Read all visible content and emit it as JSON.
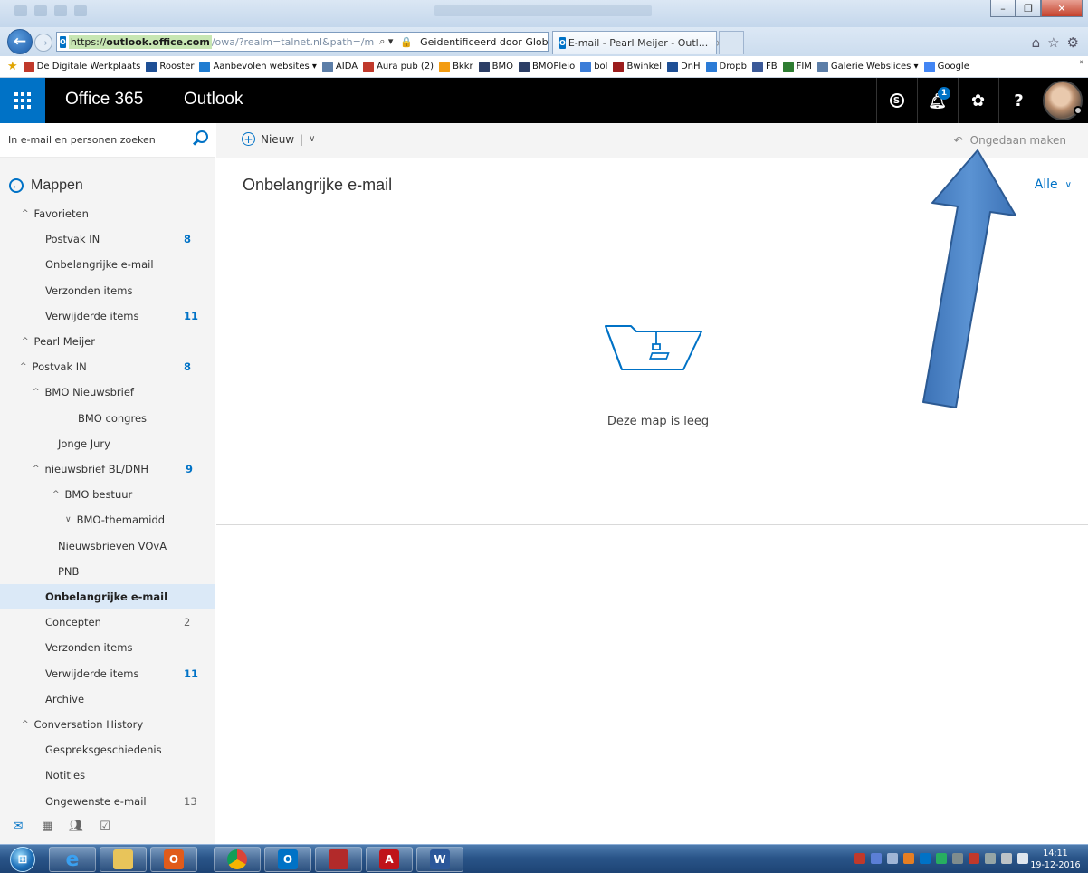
{
  "browser": {
    "address": {
      "url_prefix": "https://",
      "url_host": "outlook.office.com",
      "url_path": "/owa/?realm=talnet.nl&path=/m",
      "search_icon": "search-icon",
      "security_text": "Geidentificeerd door Glob..."
    },
    "tab": {
      "title": "E-mail - Pearl Meijer - Outl...",
      "close": "×"
    },
    "favorites": [
      {
        "label": "De Digitale Werkplaats",
        "color": "#c0392b"
      },
      {
        "label": "Rooster",
        "color": "#1e4f95"
      },
      {
        "label": "Aanbevolen websites ▾",
        "color": "#1f7cd1"
      },
      {
        "label": "AIDA",
        "color": "#5c7ea8"
      },
      {
        "label": "Aura pub (2)",
        "color": "#c0392b"
      },
      {
        "label": "Bkkr",
        "color": "#f39c12"
      },
      {
        "label": "BMO",
        "color": "#2c3e66"
      },
      {
        "label": "BMOPleio",
        "color": "#2c3e66"
      },
      {
        "label": "bol",
        "color": "#3b7dd8"
      },
      {
        "label": "Bwinkel",
        "color": "#9b1c1c"
      },
      {
        "label": "DnH",
        "color": "#1e4f95"
      },
      {
        "label": "Dropb",
        "color": "#2b7bd6"
      },
      {
        "label": "FB",
        "color": "#3b5998"
      },
      {
        "label": "FIM",
        "color": "#2e7d32"
      },
      {
        "label": "Galerie Webslices ▾",
        "color": "#5c7ea8"
      },
      {
        "label": "Google",
        "color": "#4285f4"
      }
    ]
  },
  "header": {
    "brand": "Office 365",
    "app": "Outlook",
    "notification_count": "1",
    "help": "?"
  },
  "search": {
    "placeholder": "In e-mail en personen zoeken"
  },
  "sidebar": {
    "mappen": "Mappen",
    "items": [
      {
        "label": "Favorieten",
        "count": "",
        "chev": "^",
        "indent": 0
      },
      {
        "label": "Postvak IN",
        "count": "8",
        "chev": "",
        "indent": 1
      },
      {
        "label": "Onbelangrijke e-mail",
        "count": "",
        "chev": "",
        "indent": 1
      },
      {
        "label": "Verzonden items",
        "count": "",
        "chev": "",
        "indent": 1
      },
      {
        "label": "Verwijderde items",
        "count": "11",
        "chev": "",
        "indent": 1
      },
      {
        "label": "Pearl Meijer",
        "count": "",
        "chev": "^",
        "indent": 0
      },
      {
        "label": "Postvak IN",
        "count": "8",
        "chev": "^",
        "indent": 1
      },
      {
        "label": "BMO Nieuwsbrief",
        "count": "",
        "chev": "^",
        "indent": 2
      },
      {
        "label": "BMO congres",
        "count": "",
        "chev": "",
        "indent": 3
      },
      {
        "label": "Jonge Jury",
        "count": "",
        "chev": "",
        "indent": 2
      },
      {
        "label": "nieuwsbrief BL/DNH",
        "count": "9",
        "chev": "^",
        "indent": 2
      },
      {
        "label": "BMO bestuur",
        "count": "",
        "chev": "^",
        "indent": 3
      },
      {
        "label": "BMO-themamidd",
        "count": "",
        "chev": "v",
        "indent": 4
      },
      {
        "label": "Nieuwsbrieven VOvA",
        "count": "",
        "chev": "",
        "indent": 2
      },
      {
        "label": "PNB",
        "count": "",
        "chev": "",
        "indent": 2
      },
      {
        "label": "Onbelangrijke e-mail",
        "count": "",
        "chev": "",
        "indent": 1
      },
      {
        "label": "Concepten",
        "count": "2",
        "chev": "",
        "indent": 1
      },
      {
        "label": "Verzonden items",
        "count": "",
        "chev": "",
        "indent": 1
      },
      {
        "label": "Verwijderde items",
        "count": "11",
        "chev": "",
        "indent": 1
      },
      {
        "label": "Archive",
        "count": "",
        "chev": "",
        "indent": 1
      },
      {
        "label": "Conversation History",
        "count": "",
        "chev": "^",
        "indent": 0
      },
      {
        "label": "Gespreksgeschiedenis",
        "count": "",
        "chev": "",
        "indent": 1
      },
      {
        "label": "Notities",
        "count": "",
        "chev": "",
        "indent": 1
      },
      {
        "label": "Ongewenste e-mail",
        "count": "13",
        "chev": "",
        "indent": 1
      }
    ],
    "selected_index": 15
  },
  "toolbar": {
    "new_label": "Nieuw",
    "undo_label": "Ongedaan maken"
  },
  "main": {
    "folder_title": "Onbelangrijke e-mail",
    "filter_label": "Alle",
    "empty_text": "Deze map is leeg"
  },
  "taskbar": {
    "time": "14:11",
    "date": "19-12-2016"
  },
  "colors": {
    "accent": "#0072c6",
    "arrow": "#4f86c6"
  }
}
